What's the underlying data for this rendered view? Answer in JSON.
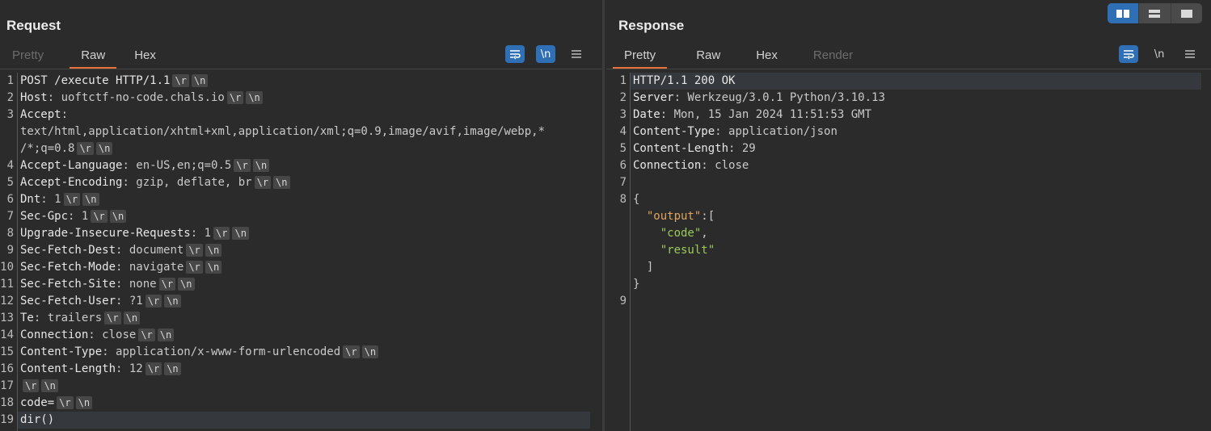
{
  "request": {
    "title": "Request",
    "tabs": [
      {
        "label": "Pretty",
        "state": "disabled"
      },
      {
        "label": "Raw",
        "state": "active"
      },
      {
        "label": "Hex",
        "state": "normal"
      }
    ],
    "toolbar": {
      "wrap_icon": "wrap-lines-icon",
      "newline_label": "\\n",
      "menu_icon": "hamburger-menu-icon"
    },
    "lines": [
      {
        "n": "1",
        "segs": [
          [
            "k",
            "POST /execute HTTP/1.1"
          ]
        ],
        "crlf": true
      },
      {
        "n": "2",
        "segs": [
          [
            "k",
            "Host"
          ],
          [
            "v",
            ": uoftctf-no-code.chals.io"
          ]
        ],
        "crlf": true
      },
      {
        "n": "3",
        "segs": [
          [
            "k",
            "Accept"
          ],
          [
            "v",
            ":"
          ]
        ],
        "crlf": false
      },
      {
        "n": "",
        "segs": [
          [
            "v",
            "text/html,application/xhtml+xml,application/xml;q=0.9,image/avif,image/webp,*"
          ]
        ],
        "crlf": false
      },
      {
        "n": "",
        "segs": [
          [
            "v",
            "/*;q=0.8"
          ]
        ],
        "crlf": true
      },
      {
        "n": "4",
        "segs": [
          [
            "k",
            "Accept-Language"
          ],
          [
            "v",
            ": en-US,en;q=0.5"
          ]
        ],
        "crlf": true
      },
      {
        "n": "5",
        "segs": [
          [
            "k",
            "Accept-Encoding"
          ],
          [
            "v",
            ": gzip, deflate, br"
          ]
        ],
        "crlf": true
      },
      {
        "n": "6",
        "segs": [
          [
            "k",
            "Dnt"
          ],
          [
            "v",
            ": 1"
          ]
        ],
        "crlf": true
      },
      {
        "n": "7",
        "segs": [
          [
            "k",
            "Sec-Gpc"
          ],
          [
            "v",
            ": 1"
          ]
        ],
        "crlf": true
      },
      {
        "n": "8",
        "segs": [
          [
            "k",
            "Upgrade-Insecure-Requests"
          ],
          [
            "v",
            ": 1"
          ]
        ],
        "crlf": true
      },
      {
        "n": "9",
        "segs": [
          [
            "k",
            "Sec-Fetch-Dest"
          ],
          [
            "v",
            ": document"
          ]
        ],
        "crlf": true
      },
      {
        "n": "10",
        "segs": [
          [
            "k",
            "Sec-Fetch-Mode"
          ],
          [
            "v",
            ": navigate"
          ]
        ],
        "crlf": true
      },
      {
        "n": "11",
        "segs": [
          [
            "k",
            "Sec-Fetch-Site"
          ],
          [
            "v",
            ": none"
          ]
        ],
        "crlf": true
      },
      {
        "n": "12",
        "segs": [
          [
            "k",
            "Sec-Fetch-User"
          ],
          [
            "v",
            ": ?1"
          ]
        ],
        "crlf": true
      },
      {
        "n": "13",
        "segs": [
          [
            "k",
            "Te"
          ],
          [
            "v",
            ": trailers"
          ]
        ],
        "crlf": true
      },
      {
        "n": "14",
        "segs": [
          [
            "k",
            "Connection"
          ],
          [
            "v",
            ": close"
          ]
        ],
        "crlf": true
      },
      {
        "n": "15",
        "segs": [
          [
            "k",
            "Content-Type"
          ],
          [
            "v",
            ": application/x-www-form-urlencoded"
          ]
        ],
        "crlf": true
      },
      {
        "n": "16",
        "segs": [
          [
            "k",
            "Content-Length"
          ],
          [
            "v",
            ": 12"
          ]
        ],
        "crlf": true
      },
      {
        "n": "17",
        "segs": [],
        "crlf": true
      },
      {
        "n": "18",
        "segs": [
          [
            "k",
            "code="
          ]
        ],
        "crlf": true
      },
      {
        "n": "19",
        "segs": [
          [
            "k",
            "dir()"
          ]
        ],
        "crlf": false,
        "highlight": true
      }
    ]
  },
  "response": {
    "title": "Response",
    "tabs": [
      {
        "label": "Pretty",
        "state": "active"
      },
      {
        "label": "Raw",
        "state": "normal"
      },
      {
        "label": "Hex",
        "state": "normal"
      },
      {
        "label": "Render",
        "state": "disabled"
      }
    ],
    "toolbar": {
      "wrap_icon": "wrap-lines-icon",
      "newline_label": "\\n",
      "menu_icon": "hamburger-menu-icon"
    },
    "lines": [
      {
        "n": "1",
        "segs": [
          [
            "k",
            "HTTP/1.1 200 OK"
          ]
        ],
        "highlight": true
      },
      {
        "n": "2",
        "segs": [
          [
            "k",
            "Server"
          ],
          [
            "v",
            ": Werkzeug/3.0.1 Python/3.10.13"
          ]
        ]
      },
      {
        "n": "3",
        "segs": [
          [
            "k",
            "Date"
          ],
          [
            "v",
            ": Mon, 15 Jan 2024 11:51:53 GMT"
          ]
        ]
      },
      {
        "n": "4",
        "segs": [
          [
            "k",
            "Content-Type"
          ],
          [
            "v",
            ": application/json"
          ]
        ]
      },
      {
        "n": "5",
        "segs": [
          [
            "k",
            "Content-Length"
          ],
          [
            "v",
            ": 29"
          ]
        ]
      },
      {
        "n": "6",
        "segs": [
          [
            "k",
            "Connection"
          ],
          [
            "v",
            ": close"
          ]
        ]
      },
      {
        "n": "7",
        "segs": []
      },
      {
        "n": "8",
        "segs": [
          [
            "v",
            "{"
          ]
        ]
      },
      {
        "n": "",
        "segs": [
          [
            "v",
            "  "
          ],
          [
            "jkey",
            "\"output\""
          ],
          [
            "v",
            ":["
          ]
        ]
      },
      {
        "n": "",
        "segs": [
          [
            "v",
            "    "
          ],
          [
            "jstr",
            "\"code\""
          ],
          [
            "v",
            ","
          ]
        ]
      },
      {
        "n": "",
        "segs": [
          [
            "v",
            "    "
          ],
          [
            "jstr",
            "\"result\""
          ]
        ]
      },
      {
        "n": "",
        "segs": [
          [
            "v",
            "  ]"
          ]
        ]
      },
      {
        "n": "",
        "segs": [
          [
            "v",
            "}"
          ]
        ]
      },
      {
        "n": "9",
        "segs": []
      }
    ]
  },
  "crlf_badges": [
    "\\r",
    "\\n"
  ],
  "layout_switcher": {
    "options": [
      {
        "name": "side-by-side-layout-icon",
        "active": true
      },
      {
        "name": "stacked-layout-icon",
        "active": false
      },
      {
        "name": "single-pane-layout-icon",
        "active": false
      }
    ]
  },
  "colors": {
    "accent_tab": "#e8703a",
    "toggle_blue": "#2f6fb6",
    "json_key": "#e0a560",
    "json_string": "#9bc95a"
  }
}
